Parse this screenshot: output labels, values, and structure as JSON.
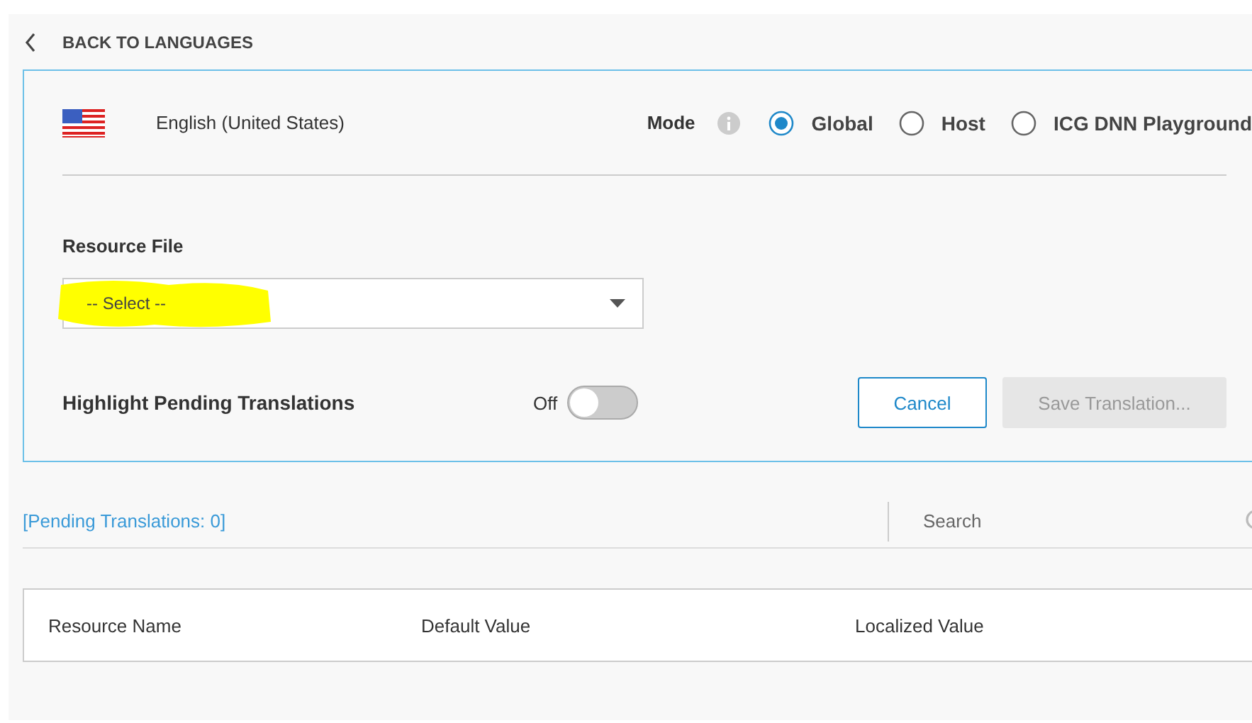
{
  "back_link": {
    "label": "BACK TO LANGUAGES"
  },
  "language": {
    "name": "English (United States)"
  },
  "mode": {
    "label": "Mode",
    "options": [
      {
        "label": "Global",
        "selected": true
      },
      {
        "label": "Host",
        "selected": false
      },
      {
        "label": "ICG DNN Playground",
        "selected": false
      }
    ]
  },
  "resource_file": {
    "label": "Resource File",
    "value": "-- Select --"
  },
  "highlight": {
    "label": "Highlight Pending Translations",
    "state_text": "Off",
    "on": false
  },
  "buttons": [
    {
      "label": "Cancel",
      "disabled": false
    },
    {
      "label": "Save Translation...",
      "disabled": true
    }
  ],
  "pending": {
    "text": "[Pending Translations: 0]"
  },
  "search": {
    "placeholder": "Search"
  },
  "table": {
    "columns": [
      "Resource Name",
      "Default Value",
      "Localized Value"
    ]
  }
}
